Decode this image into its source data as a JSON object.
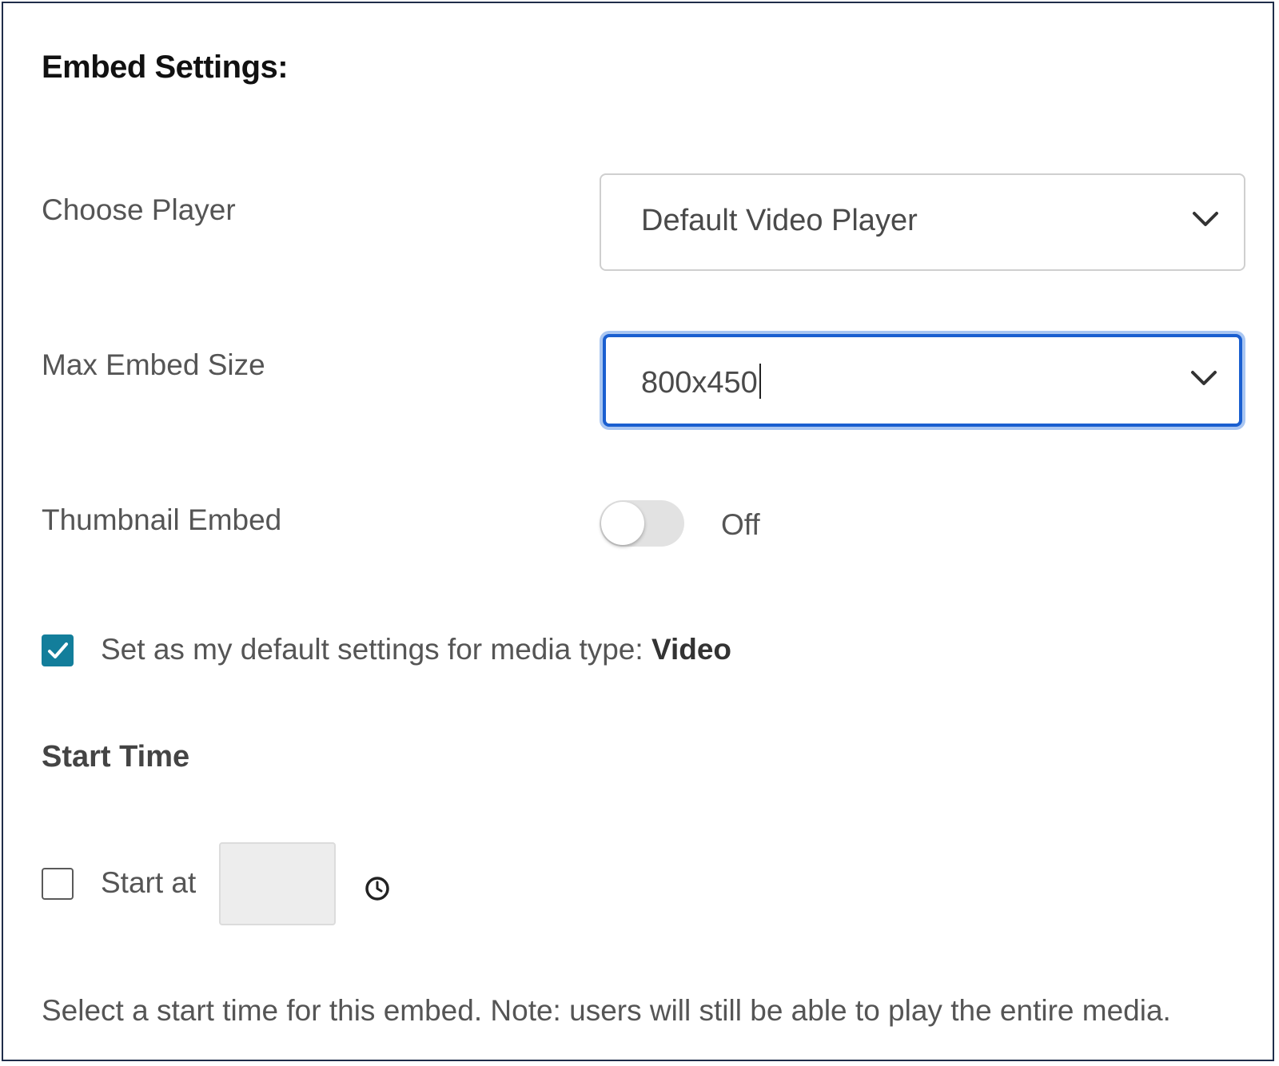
{
  "header": {
    "title": "Embed Settings:"
  },
  "choose_player": {
    "label": "Choose Player",
    "selected": "Default Video Player"
  },
  "max_embed_size": {
    "label": "Max Embed Size",
    "value": "800x450"
  },
  "thumbnail_embed": {
    "label": "Thumbnail Embed",
    "state": "Off"
  },
  "default_settings": {
    "checked": true,
    "text": "Set as my default settings for media type:",
    "media_type": "Video"
  },
  "start_time": {
    "title": "Start Time",
    "checkbox_checked": false,
    "label": "Start at",
    "value": "",
    "note": "Select a start time for this embed. Note: users will still be able to play the entire media."
  },
  "colors": {
    "focus_border": "#1a5fd0",
    "checkbox_accent": "#137e9b",
    "panel_border": "#1f2d4a"
  },
  "icons": {
    "dropdown": "chevron-down-icon",
    "check": "check-icon",
    "time": "clock-icon"
  }
}
